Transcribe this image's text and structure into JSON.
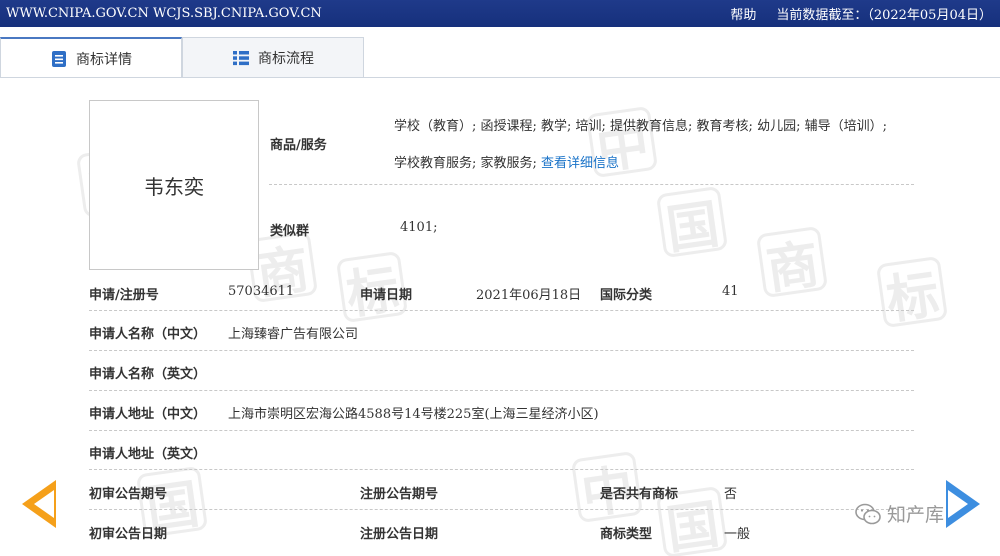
{
  "topbar": {
    "site": "WWW.CNIPA.GOV.CN WCJS.SBJ.CNIPA.GOV.CN",
    "help": "帮助",
    "data_date": "当前数据截至：（2022年05月04日）"
  },
  "tabs": [
    {
      "label": "商标详情",
      "icon": "document-list-icon",
      "active": true
    },
    {
      "label": "商标流程",
      "icon": "list-icon",
      "active": false
    }
  ],
  "mark": {
    "image_text": "韦东奕"
  },
  "goods": {
    "label": "商品/服务",
    "line1": "学校（教育）; 函授课程; 教学; 培训; 提供教育信息; 教育考核; 幼儿园; 辅导（培训）;",
    "line2": "学校教育服务; 家教服务;",
    "more_link": "查看详细信息"
  },
  "similar_group": {
    "label": "类似群",
    "value": "4101;"
  },
  "fields": {
    "reg_no_label": "申请/注册号",
    "reg_no": "57034611",
    "app_date_label": "申请日期",
    "app_date": "2021年06月18日",
    "intl_class_label": "国际分类",
    "intl_class": "41",
    "applicant_cn_label": "申请人名称（中文）",
    "applicant_cn": "上海臻睿广告有限公司",
    "applicant_en_label": "申请人名称（英文）",
    "applicant_en": "",
    "address_cn_label": "申请人地址（中文）",
    "address_cn": "上海市崇明区宏海公路4588号14号楼225室(上海三星经济小区)",
    "address_en_label": "申请人地址（英文）",
    "address_en": "",
    "prelim_no_label": "初审公告期号",
    "prelim_no": "",
    "reg_pub_no_label": "注册公告期号",
    "reg_pub_no": "",
    "shared_label": "是否共有商标",
    "shared": "否",
    "prelim_date_label": "初审公告日期",
    "prelim_date": "",
    "reg_pub_date_label": "注册公告日期",
    "reg_pub_date": "",
    "mark_type_label": "商标类型",
    "mark_type": "一般"
  },
  "watermark": {
    "chars": [
      "中",
      "国",
      "商",
      "标"
    ],
    "source": "知产库"
  },
  "colors": {
    "topbar": "#1f3a8a",
    "link": "#1a73c8",
    "arrow_left": "#f5a01a",
    "arrow_right": "#3d8ee0"
  }
}
